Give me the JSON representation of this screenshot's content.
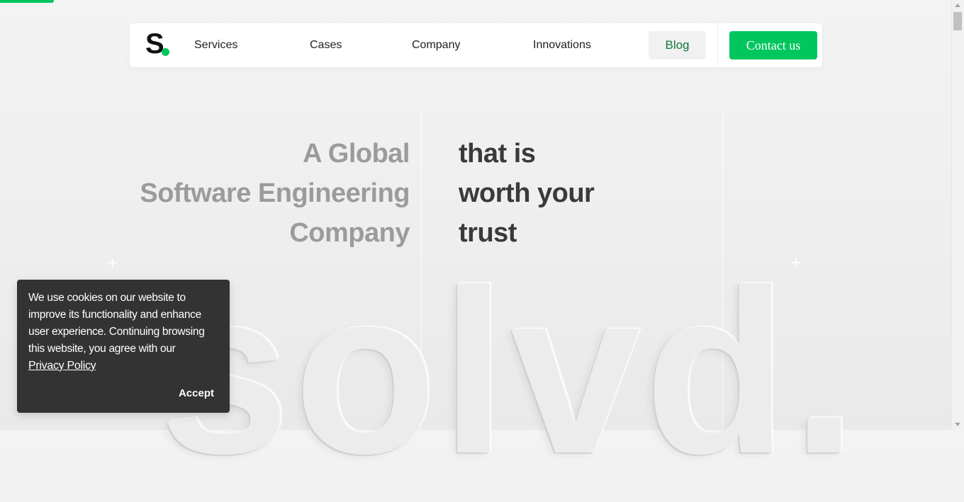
{
  "brand": {
    "logo_letter": "S",
    "accent_color": "#00c65e",
    "dark_color": "#333333"
  },
  "nav": {
    "items": [
      {
        "label": "Services"
      },
      {
        "label": "Cases"
      },
      {
        "label": "Company"
      },
      {
        "label": "Innovations"
      }
    ],
    "blog_label": "Blog",
    "contact_label": "Contact us"
  },
  "hero": {
    "left_lines": [
      "A Global",
      "Software Engineering",
      "Company"
    ],
    "right_lines": [
      "that is",
      "worth your",
      "trust"
    ],
    "big_word": "solvd."
  },
  "cookie": {
    "message": "We use cookies on our website to improve its functionality and enhance user experience. Continuing browsing this website, you agree with our",
    "link_label": "Privacy Policy",
    "accept_label": "Accept"
  },
  "icons": {
    "plus_marks": "plus-icon",
    "scroll_up": "chevron-up-icon",
    "scroll_down": "chevron-down-icon"
  }
}
